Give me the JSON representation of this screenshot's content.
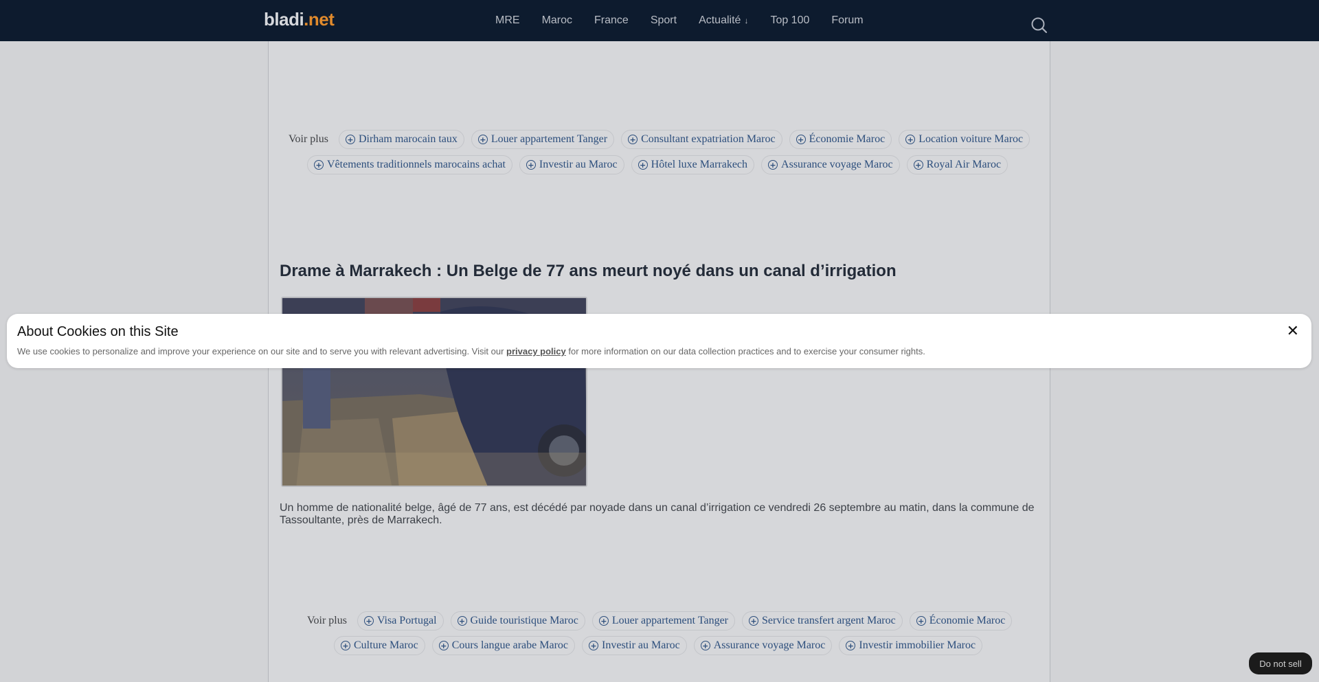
{
  "header": {
    "logo_part1": "bladi",
    "logo_part2": ".net",
    "nav": [
      {
        "label": "MRE"
      },
      {
        "label": "Maroc"
      },
      {
        "label": "France"
      },
      {
        "label": "Sport"
      },
      {
        "label": "Actualité",
        "dropdown_icon": "arrow-down-icon"
      },
      {
        "label": "Top 100"
      },
      {
        "label": "Forum"
      }
    ],
    "search_icon": "search-icon"
  },
  "related_top": {
    "label": "Voir plus",
    "tags": [
      "Dirham marocain taux",
      "Louer appartement Tanger",
      "Consultant expatriation Maroc",
      "Économie Maroc",
      "Location voiture Maroc",
      "Vêtements traditionnels marocains achat",
      "Investir au Maroc",
      "Hôtel luxe Marrakech",
      "Assurance voyage Maroc",
      "Royal Air Maroc"
    ]
  },
  "article": {
    "title": "Drame à Marrakech : Un Belge de 77 ans meurt noyé dans un canal d’irrigation",
    "body": "Un homme de nationalité belge, âgé de 77 ans, est décédé par noyade dans un canal d’irrigation ce vendredi 26 septembre au matin, dans la commune de Tassoultante, près de Marrakech."
  },
  "related_bottom": {
    "label": "Voir plus",
    "tags": [
      "Visa Portugal",
      "Guide touristique Maroc",
      "Louer appartement Tanger",
      "Service transfert argent Maroc",
      "Économie Maroc",
      "Culture Maroc",
      "Cours langue arabe Maroc",
      "Investir au Maroc",
      "Assurance voyage Maroc",
      "Investir immobilier Maroc"
    ]
  },
  "cookie_banner": {
    "title": "About Cookies on this Site",
    "text_before": "We use cookies to personalize and improve your experience on our site and to serve you with relevant advertising. Visit our ",
    "link": "privacy policy",
    "text_after": " for more information on our data collection practices and to exercise your consumer rights.",
    "close": "✕"
  },
  "do_not_sell": "Do not sell",
  "colors": {
    "header_bg": "#0d1b2e",
    "logo_accent": "#e08a2c",
    "tag_text": "#2c4e7c"
  }
}
